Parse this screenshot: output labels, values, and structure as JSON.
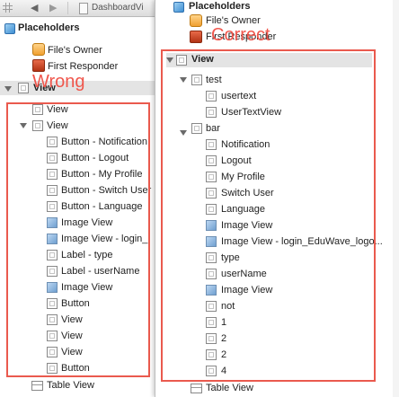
{
  "toolbar": {
    "file_name": "DashboardVi"
  },
  "placeholders": {
    "header": "Placeholders",
    "files_owner": "File's Owner",
    "first_responder": "First Responder"
  },
  "annotations": {
    "wrong": "Wrong",
    "correct": "Correct"
  },
  "left_outline": {
    "root": "View",
    "items": [
      "View",
      "View",
      "Button - Notification",
      "Button - Logout",
      "Button - My Profile",
      "Button - Switch User",
      "Button - Language",
      "Image View",
      "Image View - login_",
      "Label - type",
      "Label - userName",
      "Image View",
      "Button",
      "View",
      "View",
      "View",
      "Button"
    ],
    "after": "Table View"
  },
  "right_outline": {
    "root": "View",
    "items": [
      "test",
      "usertext",
      "UserTextView",
      "bar",
      "Notification",
      "Logout",
      "My Profile",
      "Switch User",
      "Language",
      "Image View",
      "Image View - login_EduWave_logo...",
      "type",
      "userName",
      "Image View",
      "not",
      "1",
      "2",
      "2",
      "4"
    ],
    "after": "Table View"
  },
  "colors": {
    "annotation": "#f0564c",
    "highlight_box": "#ea5a4e",
    "selected_row": "#e4e4e4"
  }
}
